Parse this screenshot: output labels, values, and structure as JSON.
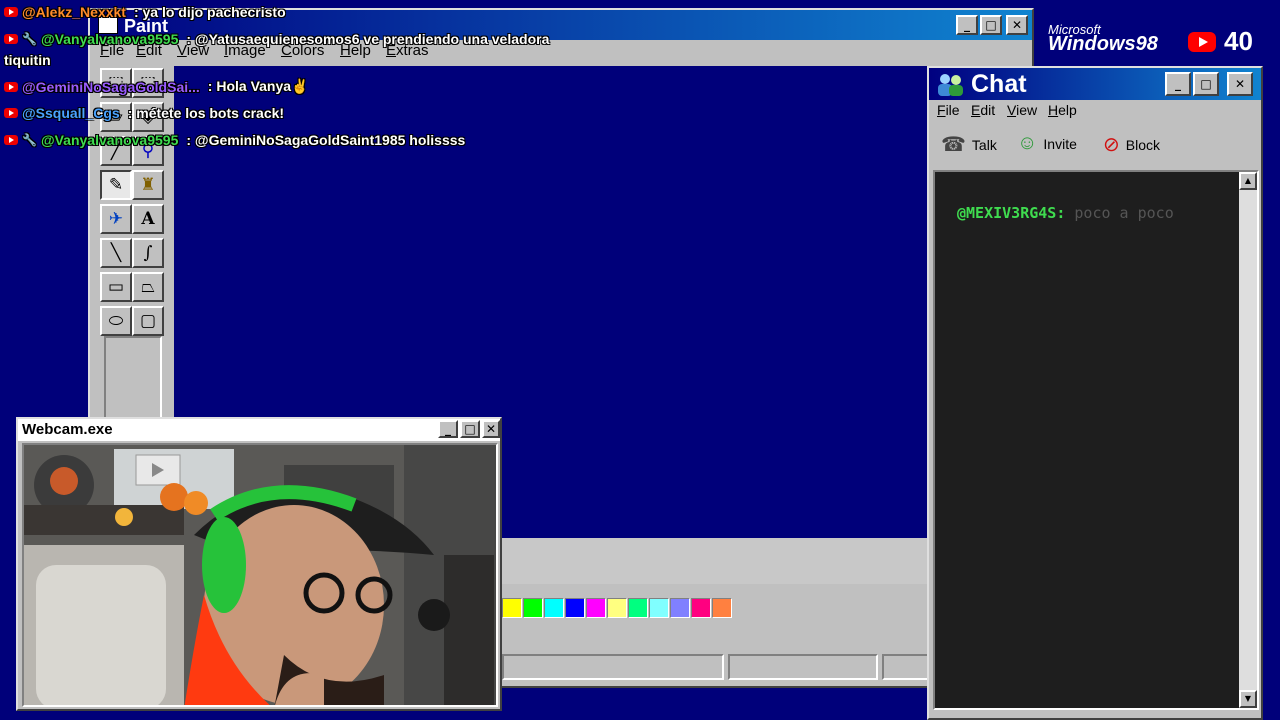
{
  "paint": {
    "title": "Paint",
    "menu": [
      "File",
      "Edit",
      "View",
      "Image",
      "Colors",
      "Help",
      "Extras"
    ],
    "tools": [
      {
        "name": "free-select-icon",
        "glyph": "⬚"
      },
      {
        "name": "select-icon",
        "glyph": "⬚"
      },
      {
        "name": "eraser-icon",
        "glyph": "▱"
      },
      {
        "name": "fill-icon",
        "glyph": "⛾"
      },
      {
        "name": "color-picker-icon",
        "glyph": "⚲"
      },
      {
        "name": "magnifier-icon",
        "glyph": "🔍"
      },
      {
        "name": "pencil-icon",
        "glyph": "✎"
      },
      {
        "name": "brush-icon",
        "glyph": "🖌"
      },
      {
        "name": "airbrush-icon",
        "glyph": "✈"
      },
      {
        "name": "text-icon",
        "glyph": "A"
      },
      {
        "name": "line-icon",
        "glyph": "╲"
      },
      {
        "name": "curve-icon",
        "glyph": "∫"
      },
      {
        "name": "rectangle-icon",
        "glyph": "▭"
      },
      {
        "name": "polygon-icon",
        "glyph": "⏢"
      },
      {
        "name": "ellipse-icon",
        "glyph": "⬭"
      },
      {
        "name": "rounded-rectangle-icon",
        "glyph": "▢"
      }
    ],
    "palette": [
      "#ffff00",
      "#00ff00",
      "#00ffff",
      "#0000ff",
      "#ff00ff",
      "#ffff80",
      "#00ff80",
      "#80ffff",
      "#8080ff",
      "#ff0080",
      "#ff8040"
    ]
  },
  "webcam": {
    "title": "Webcam.exe"
  },
  "chat_window": {
    "title": "Chat",
    "menu": [
      "File",
      "Edit",
      "View",
      "Help"
    ],
    "toolbar": {
      "talk": "Talk",
      "invite": "Invite",
      "block": "Block"
    },
    "message": {
      "user": "@MEXIV3RG4S:",
      "text": "poco a poco"
    }
  },
  "overlay_chat": [
    {
      "user": "@Alekz_Nexxkt",
      "text": ": ya lo dijo pachecristo",
      "user_color": "#ff8c2b",
      "badge": "yt"
    },
    {
      "user": "@Vanyalvanova9595",
      "text": ": @Yatusaequienesomos6 ve prendiendo una veladora",
      "user_color": "#3fdc4f",
      "badge": "yt-mod"
    },
    {
      "user": "",
      "text": "tiquitin",
      "user_color": "#ffffff",
      "badge": ""
    },
    {
      "user": "@GeminiNoSagaGoldSai...",
      "text": ": Hola Vanya✌",
      "user_color": "#9a5cff",
      "badge": "yt"
    },
    {
      "user": "@Ssquall_Cgs",
      "text": ": métete los bots crack!",
      "user_color": "#4aa3ff",
      "badge": "yt"
    },
    {
      "user": "@Vanyalvanova9595",
      "text": ": @GeminiNoSagaGoldSaint1985 holissss",
      "user_color": "#3fdc4f",
      "badge": "yt-mod"
    }
  ],
  "branding": {
    "ms": "Microsoft",
    "os": "Windows98",
    "viewer_count": "40"
  }
}
